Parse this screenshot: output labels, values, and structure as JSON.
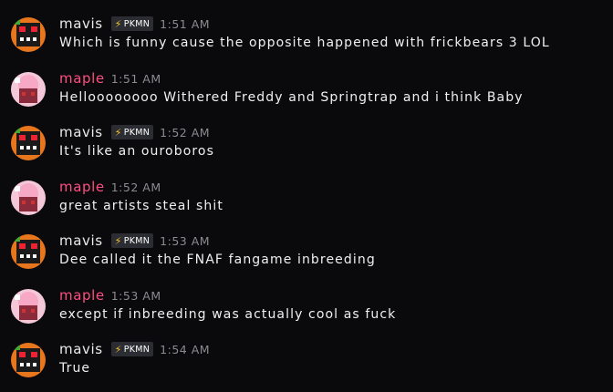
{
  "messages": [
    {
      "user": "mavis",
      "badge": "PKMN",
      "time": "1:51  AM",
      "text": "Which is funny cause the opposite happened with frickbears 3 LOL"
    },
    {
      "user": "maple",
      "badge": "",
      "time": "1:51  AM",
      "text": "Helloooooooo Withered Freddy and Springtrap and i think Baby"
    },
    {
      "user": "mavis",
      "badge": "PKMN",
      "time": "1:52  AM",
      "text": "It's like an ouroboros"
    },
    {
      "user": "maple",
      "badge": "",
      "time": "1:52  AM",
      "text": "great artists steal shit"
    },
    {
      "user": "mavis",
      "badge": "PKMN",
      "time": "1:53  AM",
      "text": "Dee called it the FNAF fangame inbreeding"
    },
    {
      "user": "maple",
      "badge": "",
      "time": "1:53  AM",
      "text": "except if inbreeding was actually cool as fuck"
    },
    {
      "user": "mavis",
      "badge": "PKMN",
      "time": "1:54  AM",
      "text": "True"
    }
  ],
  "colors": {
    "background": "#0a0a0c",
    "mavis_name": "#eaeaea",
    "maple_name": "#ff4f82",
    "badge_bg": "#2b2d33",
    "bolt": "#f7c52b",
    "timestamp": "#8b8b90"
  },
  "icons": {
    "badge": "lightning-bolt-icon",
    "mavis_avatar": "robot-avatar",
    "maple_avatar": "pink-character-avatar"
  }
}
